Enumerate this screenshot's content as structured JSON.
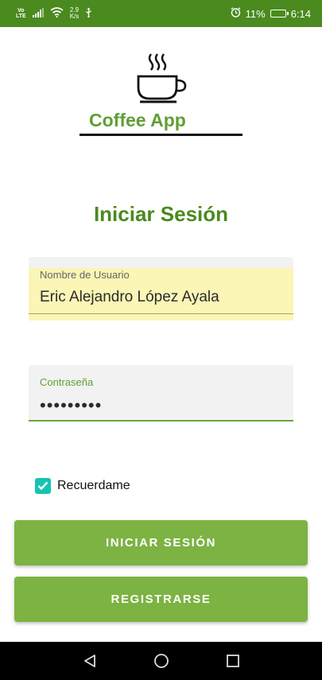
{
  "status_bar": {
    "network_top": "Vo",
    "network_bottom": "LTE",
    "speed_value": "2.9",
    "speed_unit": "K/s",
    "battery": "11%",
    "time": "6:14"
  },
  "logo": {
    "text": "Coffee App",
    "icon": "coffee-cup-icon"
  },
  "title": "Iniciar Sesión",
  "username_field": {
    "label": "Nombre de Usuario",
    "value": "Eric Alejandro López Ayala"
  },
  "password_field": {
    "label": "Contraseña",
    "value": "•••••••••"
  },
  "remember": {
    "label": "Recuerdame",
    "checked": true
  },
  "buttons": {
    "login": "INICIAR SESIÓN",
    "register": "REGISTRARSE"
  },
  "colors": {
    "status_bar": "#4a8a1e",
    "primary": "#7cb342",
    "title": "#4a8a1e",
    "checkbox": "#17c3b2",
    "autofill": "#fbf5b6"
  }
}
